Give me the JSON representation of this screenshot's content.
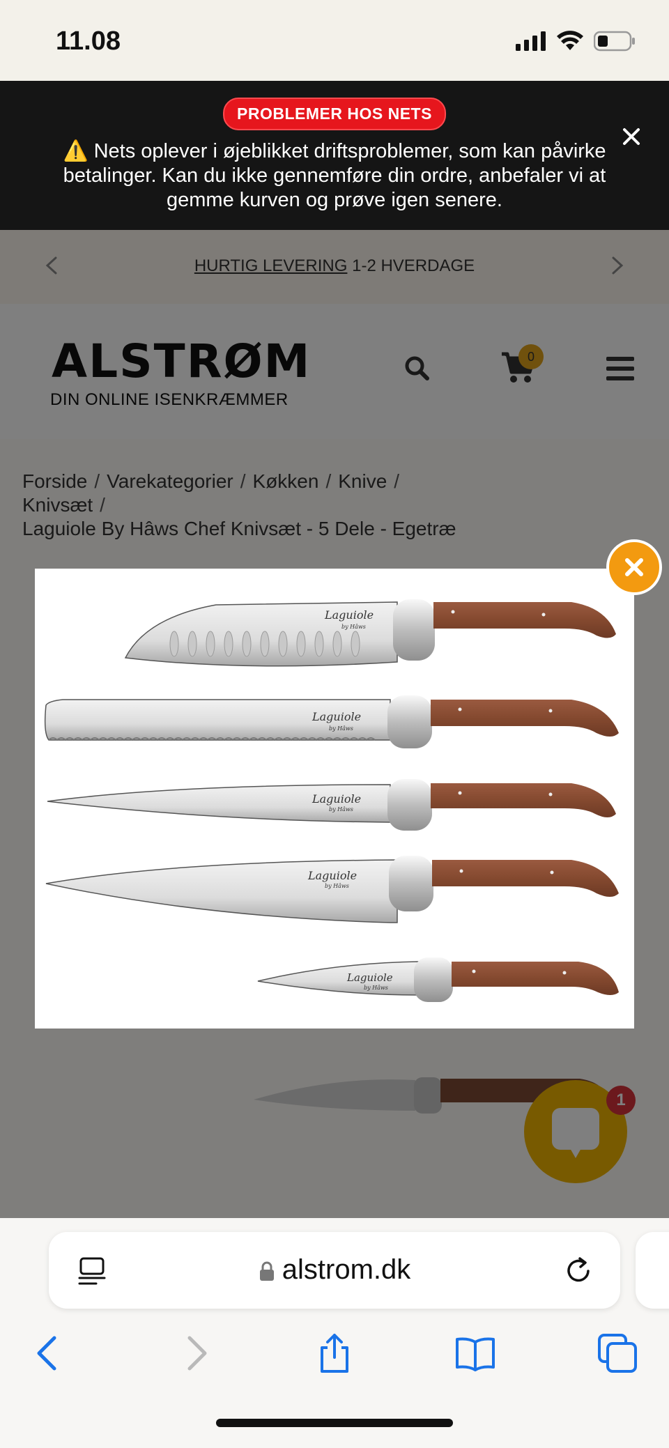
{
  "status_bar": {
    "time": "11.08"
  },
  "alert": {
    "badge": "PROBLEMER HOS NETS",
    "message": "⚠️ Nets oplever i øjeblikket driftsproblemer, som kan påvirke betalinger. Kan du ikke gennemføre din ordre, anbefaler vi at gemme kurven og prøve igen senere."
  },
  "promo": {
    "highlight": "HURTIG LEVERING",
    "rest": " 1-2 HVERDAGE"
  },
  "header": {
    "logo": "ALSTRØM",
    "tagline": "DIN ONLINE ISENKRÆMMER",
    "cart_count": "0"
  },
  "breadcrumb": {
    "items": [
      "Forside",
      "Varekategorier",
      "Køkken",
      "Knive",
      "Knivsæt"
    ],
    "separator": "/",
    "current": "Laguiole By Hâws Chef Knivsæt - 5 Dele - Egetræ"
  },
  "modal": {
    "knife_engraving": "Laguiole",
    "knife_sub": "by Hâws"
  },
  "chat": {
    "badge": "1"
  },
  "safari": {
    "url": "alstrom.dk"
  },
  "colors": {
    "alert_badge": "#e6161d",
    "accent": "#f39a10",
    "chat": "#f0b400"
  }
}
